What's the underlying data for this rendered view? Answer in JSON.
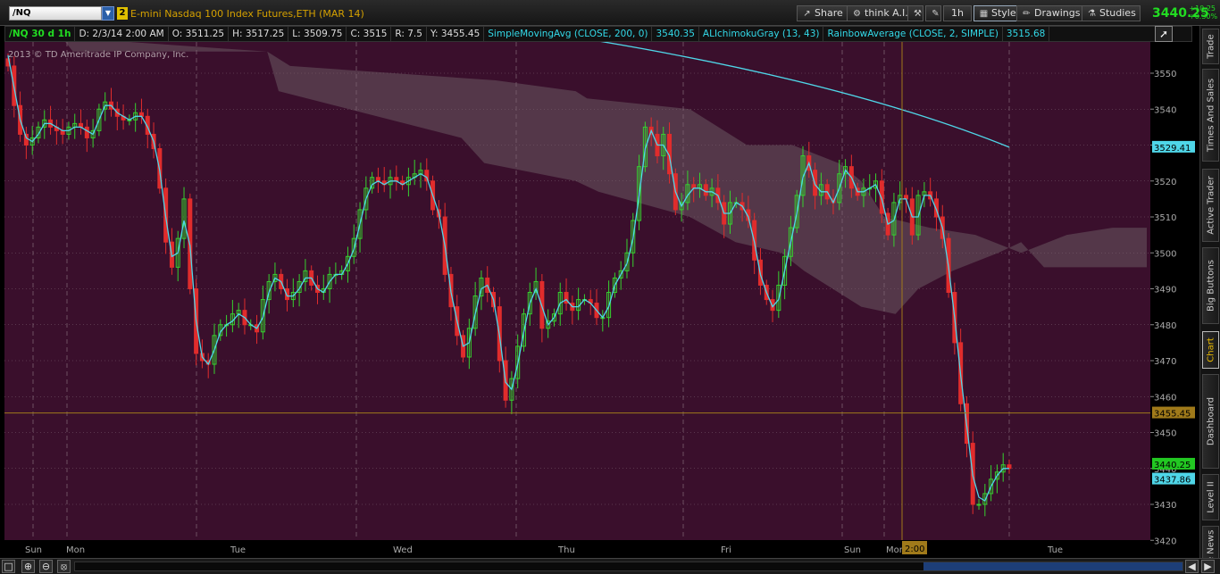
{
  "toolbar": {
    "symbol": "/NQ",
    "link_number": "2",
    "description": "E-mini Nasdaq 100 Index Futures,ETH (MAR 14)",
    "share_label": "Share",
    "think_label": "think A.I.",
    "timeframe_label": "1h",
    "style_label": "Style",
    "drawings_label": "Drawings",
    "studies_label": "Studies",
    "last_price": "3440.25",
    "net_change": "+10.25",
    "pct_change": "+0.30%"
  },
  "infobar": {
    "symbol_period": "/NQ 30 d 1h",
    "date": "D: 2/3/14 2:00 AM",
    "open": "O: 3511.25",
    "high": "H: 3517.25",
    "low": "L: 3509.75",
    "close": "C: 3515",
    "range": "R: 7.5",
    "y": "Y: 3455.45",
    "sma_label": "SimpleMovingAvg (CLOSE, 200, 0)",
    "sma_value": "3540.35",
    "ichimoku_label": "ALIchimokuGray (13, 43)",
    "rainbow_label": "RainbowAverage (CLOSE, 2, SIMPLE)",
    "rainbow_value": "3515.68"
  },
  "copyright": "2013 © TD Ameritrade IP Company, Inc.",
  "right_tabs": [
    "Trade",
    "Times And Sales",
    "Active Trader",
    "Big Buttons",
    "Chart",
    "Dashboard",
    "Level II",
    "Live News"
  ],
  "active_tab": "Chart",
  "colors": {
    "background": "#3a0f2c",
    "up": "#36d12f",
    "down": "#e02c2c",
    "ma": "#4fd6e8",
    "sma200": "#4fd6e8",
    "cloud": "#6a5a62",
    "crosshair": "#a07a1a",
    "grid": "#7a6070"
  },
  "chart_data": {
    "type": "candlestick",
    "y_axis": {
      "min": 3420,
      "max": 3560,
      "ticks": [
        3420,
        3430,
        3440,
        3450,
        3460,
        3470,
        3480,
        3490,
        3500,
        3510,
        3520,
        3530,
        3540,
        3550
      ]
    },
    "x_labels": [
      "Sun",
      "Mon",
      "Tue",
      "Wed",
      "Thu",
      "Fri",
      "Sun",
      "Mon",
      "Tue"
    ],
    "cursor_time_label": "2:00",
    "cursor_y_label": "3455.45",
    "labels": {
      "sma200_end": "3529.41",
      "last": "3440.25",
      "ma_last": "3437.86"
    },
    "closes": [
      3552,
      3541,
      3533,
      3530,
      3532,
      3535,
      3537,
      3535,
      3534,
      3533,
      3535,
      3536,
      3535,
      3532,
      3534,
      3540,
      3542,
      3540,
      3538,
      3537,
      3537,
      3539,
      3538,
      3533,
      3529,
      3518,
      3503,
      3496,
      3504,
      3515,
      3490,
      3472,
      3470,
      3469,
      3477,
      3480,
      3480,
      3483,
      3484,
      3480,
      3480,
      3478,
      3487,
      3492,
      3494,
      3490,
      3487,
      3489,
      3492,
      3495,
      3491,
      3489,
      3490,
      3494,
      3494,
      3495,
      3499,
      3504,
      3512,
      3518,
      3521,
      3520,
      3519,
      3521,
      3520,
      3519,
      3521,
      3522,
      3523,
      3520,
      3512,
      3510,
      3494,
      3485,
      3477,
      3471,
      3479,
      3488,
      3493,
      3489,
      3485,
      3470,
      3459,
      3465,
      3474,
      3483,
      3489,
      3492,
      3479,
      3481,
      3483,
      3489,
      3486,
      3484,
      3487,
      3487,
      3486,
      3482,
      3482,
      3489,
      3493,
      3495,
      3500,
      3509,
      3524,
      3535,
      3533,
      3527,
      3533,
      3522,
      3512,
      3514,
      3519,
      3518,
      3519,
      3516,
      3518,
      3514,
      3508,
      3514,
      3514,
      3512,
      3509,
      3498,
      3491,
      3487,
      3484,
      3491,
      3499,
      3507,
      3516,
      3527,
      3523,
      3516,
      3519,
      3515,
      3514,
      3522,
      3524,
      3518,
      3516,
      3518,
      3518,
      3520,
      3511,
      3505,
      3514,
      3516,
      3515,
      3505,
      3516,
      3517,
      3515,
      3510,
      3504,
      3489,
      3475,
      3458,
      3447,
      3430,
      3430,
      3433,
      3437,
      3439,
      3441,
      3440
    ],
    "ma_values": [
      3555,
      3546,
      3537,
      3532,
      3531,
      3533,
      3536,
      3536,
      3535,
      3534,
      3534,
      3535,
      3535,
      3534,
      3533,
      3537,
      3541,
      3541,
      3539,
      3538,
      3537,
      3538,
      3538,
      3535,
      3531,
      3523,
      3510,
      3499,
      3500,
      3509,
      3502,
      3481,
      3471,
      3469,
      3473,
      3478,
      3480,
      3481,
      3483,
      3482,
      3480,
      3479,
      3482,
      3489,
      3493,
      3492,
      3488,
      3488,
      3490,
      3493,
      3493,
      3490,
      3489,
      3492,
      3494,
      3494,
      3497,
      3501,
      3508,
      3515,
      3519,
      3520,
      3519,
      3520,
      3520,
      3519,
      3520,
      3521,
      3522,
      3521,
      3516,
      3511,
      3502,
      3489,
      3481,
      3474,
      3475,
      3483,
      3490,
      3491,
      3487,
      3477,
      3464,
      3462,
      3469,
      3478,
      3486,
      3490,
      3485,
      3480,
      3482,
      3486,
      3487,
      3485,
      3485,
      3487,
      3486,
      3484,
      3482,
      3485,
      3491,
      3494,
      3497,
      3504,
      3516,
      3529,
      3534,
      3530,
      3530,
      3527,
      3517,
      3513,
      3516,
      3518,
      3518,
      3517,
      3517,
      3516,
      3511,
      3511,
      3514,
      3513,
      3510,
      3503,
      3494,
      3489,
      3485,
      3487,
      3495,
      3503,
      3511,
      3521,
      3525,
      3519,
      3517,
      3517,
      3514,
      3518,
      3523,
      3521,
      3517,
      3517,
      3518,
      3519,
      3515,
      3508,
      3509,
      3515,
      3515,
      3510,
      3510,
      3516,
      3516,
      3512,
      3507,
      3496,
      3482,
      3466,
      3452,
      3438,
      3432,
      3431,
      3435,
      3438,
      3440,
      3440
    ],
    "sma200": {
      "start": [
        0.5,
        3560
      ],
      "end": [
        1.0,
        3529.41
      ]
    },
    "cloud_upper": [
      [
        0.05,
        3560
      ],
      [
        0.06,
        3556
      ],
      [
        0.23,
        3556
      ],
      [
        0.25,
        3552
      ],
      [
        0.43,
        3548
      ],
      [
        0.5,
        3545
      ],
      [
        0.51,
        3543
      ],
      [
        0.6,
        3540
      ],
      [
        0.65,
        3530
      ],
      [
        0.69,
        3530
      ],
      [
        0.73,
        3525
      ],
      [
        0.75,
        3520
      ],
      [
        0.77,
        3510
      ],
      [
        0.81,
        3507
      ],
      [
        0.85,
        3505
      ],
      [
        0.89,
        3500
      ],
      [
        0.93,
        3505
      ],
      [
        0.97,
        3507
      ],
      [
        1.0,
        3507
      ]
    ],
    "cloud_lower": [
      [
        0.05,
        3560
      ],
      [
        0.23,
        3556
      ],
      [
        0.24,
        3545
      ],
      [
        0.4,
        3532
      ],
      [
        0.42,
        3525
      ],
      [
        0.5,
        3520
      ],
      [
        0.52,
        3517
      ],
      [
        0.6,
        3510
      ],
      [
        0.64,
        3503
      ],
      [
        0.68,
        3500
      ],
      [
        0.7,
        3495
      ],
      [
        0.75,
        3485
      ],
      [
        0.78,
        3483
      ],
      [
        0.8,
        3490
      ],
      [
        0.83,
        3495
      ],
      [
        0.87,
        3500
      ],
      [
        0.89,
        3503
      ],
      [
        0.91,
        3496
      ],
      [
        1.0,
        3496
      ]
    ]
  }
}
